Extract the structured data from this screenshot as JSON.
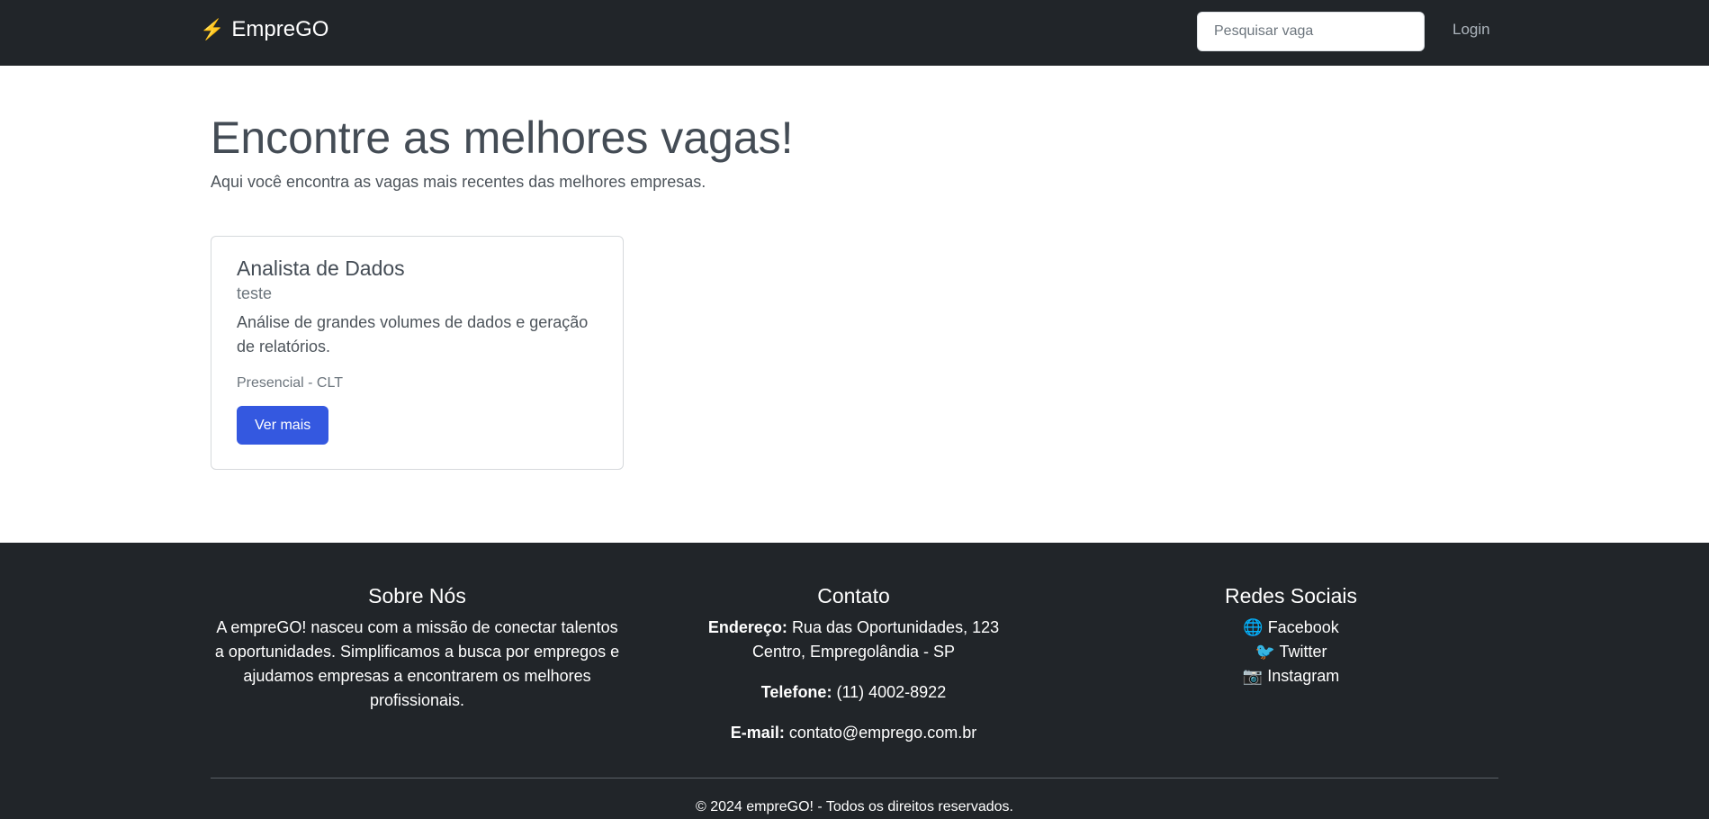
{
  "nav": {
    "brand_icon": "⚡",
    "brand_text": "EmpreGO",
    "search_placeholder": "Pesquisar vaga",
    "login_label": "Login"
  },
  "hero": {
    "title": "Encontre as melhores vagas!",
    "subtitle": "Aqui você encontra as vagas mais recentes das melhores empresas."
  },
  "jobs": [
    {
      "title": "Analista de Dados",
      "company": "teste",
      "description": "Análise de grandes volumes de dados e geração de relatórios.",
      "meta": "Presencial - CLT",
      "button_label": "Ver mais"
    }
  ],
  "footer": {
    "about": {
      "heading": "Sobre Nós",
      "text": "A empreGO! nasceu com a missão de conectar talentos a oportunidades. Simplificamos a busca por empregos e ajudamos empresas a encontrarem os melhores profissionais."
    },
    "contact": {
      "heading": "Contato",
      "address_label": "Endereço:",
      "address_line1": "Rua das Oportunidades, 123",
      "address_line2": "Centro, Empregolândia - SP",
      "phone_label": "Telefone:",
      "phone": "(11) 4002-8922",
      "email_label": "E-mail:",
      "email": "contato@emprego.com.br"
    },
    "social": {
      "heading": "Redes Sociais",
      "links": [
        {
          "icon": "🌐",
          "label": "Facebook"
        },
        {
          "icon": "🐦",
          "label": "Twitter"
        },
        {
          "icon": "📷",
          "label": "Instagram"
        }
      ]
    },
    "copyright": "© 2024 empreGO! - Todos os direitos reservados."
  },
  "colors": {
    "navbar_bg": "#212529",
    "primary_button": "#3458e0",
    "brand_icon": "#f5b400"
  }
}
